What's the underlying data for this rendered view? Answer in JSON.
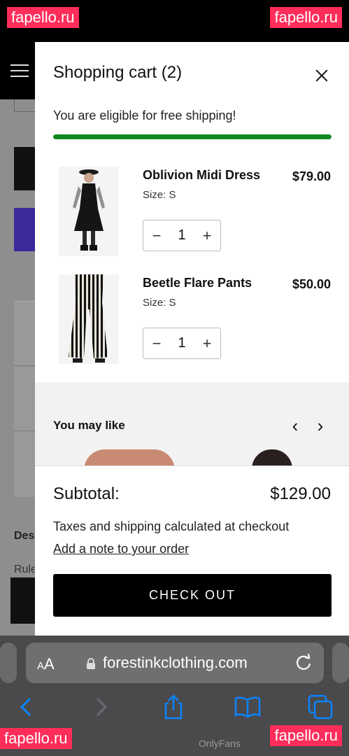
{
  "watermark": {
    "text": "fapello.ru",
    "bottom_text": "fapello.ru",
    "faint_text": "OnlyFans"
  },
  "cart": {
    "title": "Shopping cart (2)",
    "shipping_message": "You are eligible for free shipping!",
    "shipping_progress": 1.0,
    "progress_color": "#118a22",
    "items": [
      {
        "name": "Oblivion Midi Dress",
        "size": "Size: S",
        "price": "$79.00",
        "quantity": "1"
      },
      {
        "name": "Beetle Flare Pants",
        "size": "Size: S",
        "price": "$50.00",
        "quantity": "1"
      }
    ],
    "qty_minus": "−",
    "qty_plus": "+",
    "you_may_like": {
      "title": "You may like",
      "prev": "‹",
      "next": "›"
    },
    "subtotal_label": "Subtotal:",
    "subtotal_value": "$129.00",
    "tax_note": "Taxes and shipping calculated at checkout",
    "add_note": "Add a note to your order",
    "checkout_label": "CHECK OUT"
  },
  "background_page": {
    "heading_fragment": "Des",
    "text_fragment": "Rule"
  },
  "browser": {
    "text_size_big": "A",
    "text_size_small": "A",
    "url": "forestinkclothing.com",
    "icons": [
      "lock-icon",
      "reload-icon",
      "back-icon",
      "forward-icon",
      "share-icon",
      "bookmarks-icon",
      "tabs-icon"
    ],
    "accent_color": "#0a84ff"
  }
}
